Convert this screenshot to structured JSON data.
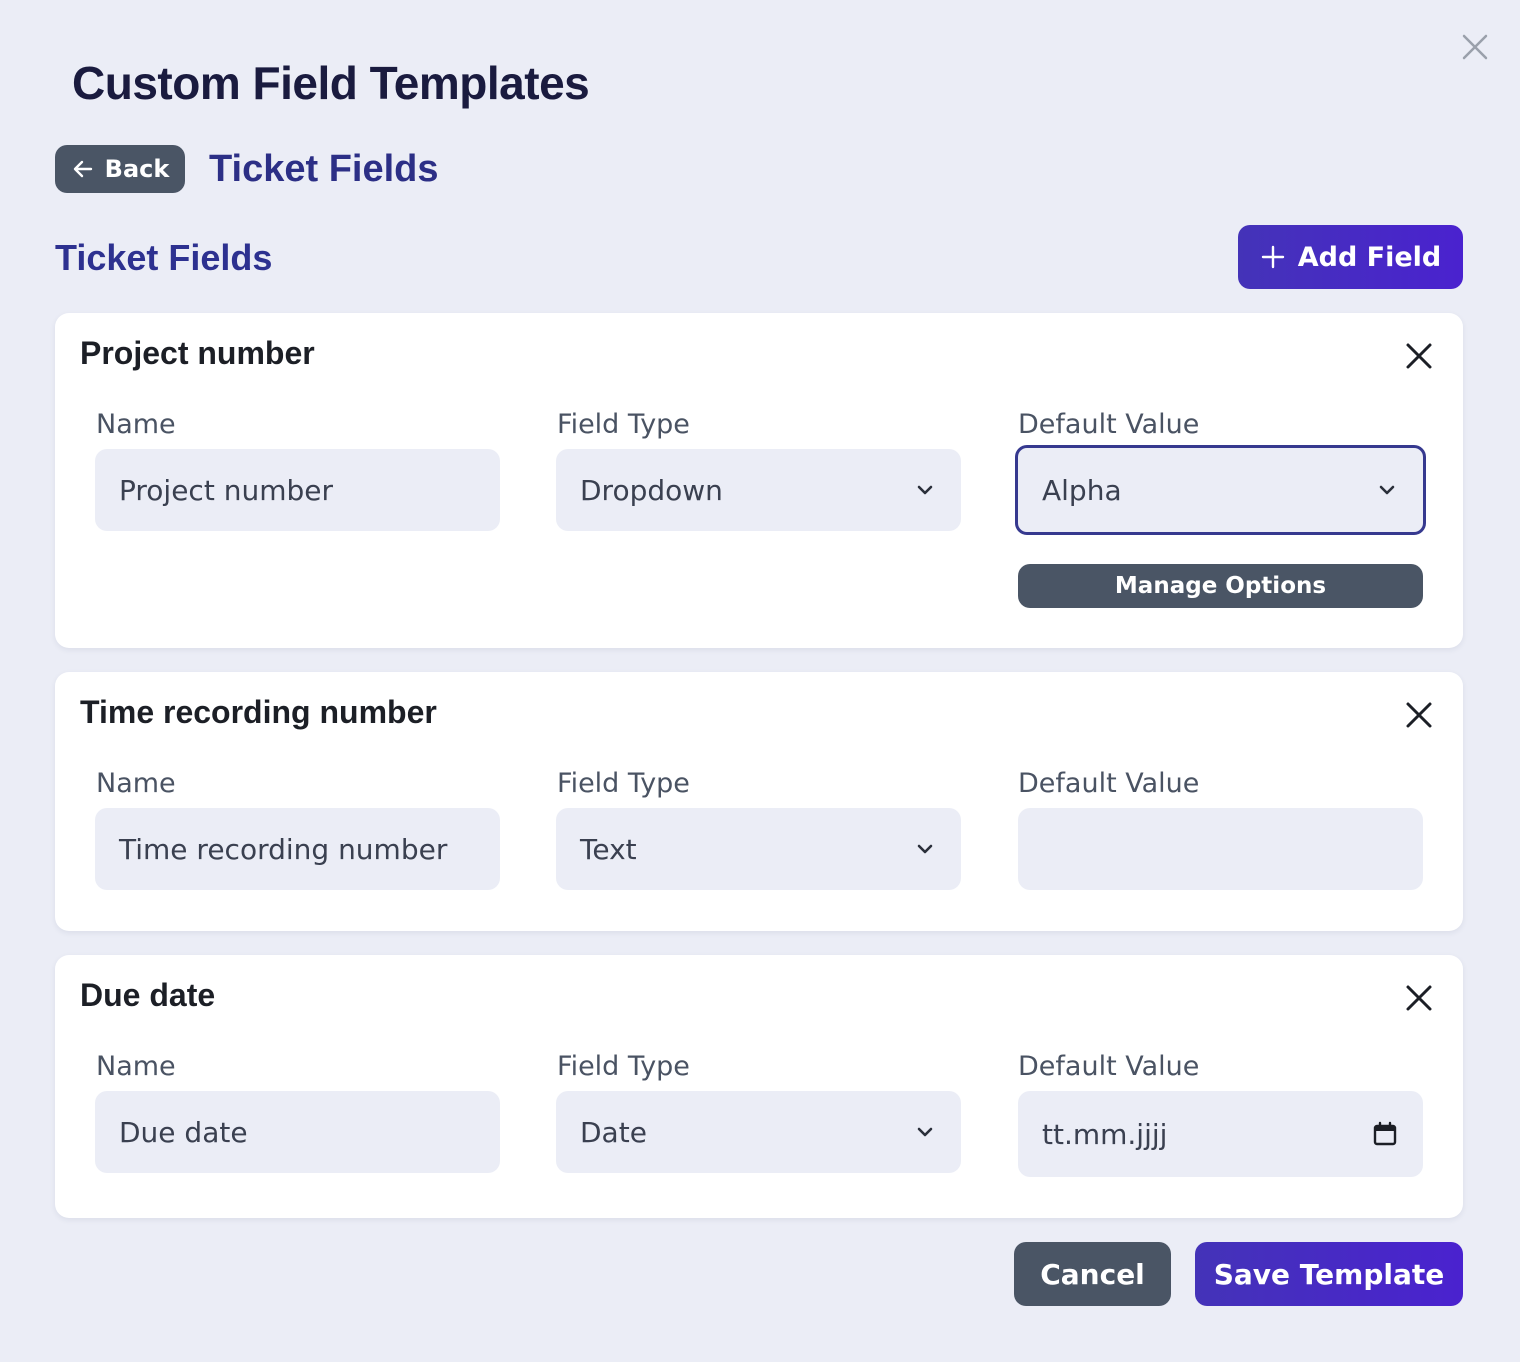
{
  "header": {
    "title": "Custom Field Templates",
    "close_icon": "close-icon"
  },
  "breadcrumb": {
    "back_label": "Back",
    "current": "Ticket Fields"
  },
  "section": {
    "title": "Ticket Fields",
    "add_label": "Add Field"
  },
  "labels": {
    "name": "Name",
    "field_type": "Field Type",
    "default_value": "Default Value"
  },
  "fields": [
    {
      "title": "Project number",
      "name": "Project number",
      "type": "Dropdown",
      "default": "Alpha",
      "manage_label": "Manage Options"
    },
    {
      "title": "Time recording number",
      "name": "Time recording number",
      "type": "Text",
      "default": ""
    },
    {
      "title": "Due date",
      "name": "Due date",
      "type": "Date",
      "default_placeholder": "tt.mm.jjjj"
    }
  ],
  "footer": {
    "cancel_label": "Cancel",
    "save_label": "Save Template"
  },
  "colors": {
    "background": "#ebedf6",
    "primary": "#4a22cf",
    "secondary_button": "#4a5565",
    "heading": "#2d3190"
  }
}
